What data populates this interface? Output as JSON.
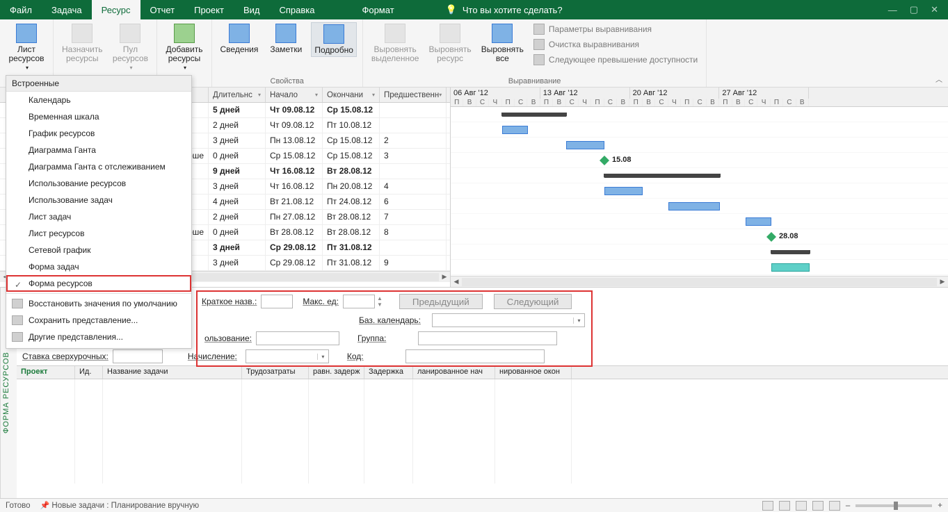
{
  "tabs": [
    "Файл",
    "Задача",
    "Ресурс",
    "Отчет",
    "Проект",
    "Вид",
    "Справка",
    "Формат"
  ],
  "active_tab_index": 2,
  "tellme": "Что вы хотите сделать?",
  "ribbon": {
    "group1": {
      "big1": "Лист\nресурсов",
      "drop": "▾"
    },
    "group2": {
      "b1": "Назначить\nресурсы",
      "b2": "Пул\nресурсов",
      "drop": "▾"
    },
    "group3": {
      "b1": "Добавить\nресурсы",
      "drop": "▾"
    },
    "group4": {
      "b1": "Сведения",
      "b2": "Заметки",
      "b3": "Подробно",
      "label": "Свойства"
    },
    "group5": {
      "b1": "Выровнять\nвыделенное",
      "b2": "Выровнять\nресурс",
      "b3": "Выровнять\nвсе",
      "s1": "Параметры выравнивания",
      "s2": "Очистка выравнивания",
      "s3": "Следующее превышение доступности",
      "label": "Выравнивание"
    }
  },
  "dropdown": {
    "header": "Встроенные",
    "items": [
      "Календарь",
      "Временная шкала",
      "График ресурсов",
      "Диаграмма Ганта",
      "Диаграмма Ганта с отслеживанием",
      "Использование ресурсов",
      "Использование задач",
      "Лист задач",
      "Лист ресурсов",
      "Сетевой график",
      "Форма задач",
      "Форма ресурсов"
    ],
    "footer": [
      "Восстановить значения по умолчанию",
      "Сохранить представление...",
      "Другие представления..."
    ]
  },
  "cols": [
    "Длительнс",
    "Начало",
    "Окончани",
    "Предшественн"
  ],
  "rows": [
    {
      "bold": true,
      "pre": "",
      "dur": "5 дней",
      "s": "Чт 09.08.12",
      "e": "Ср 15.08.12",
      "p": ""
    },
    {
      "bold": false,
      "pre": "",
      "dur": "2 дней",
      "s": "Чт 09.08.12",
      "e": "Пт 10.08.12",
      "p": ""
    },
    {
      "bold": false,
      "pre": "",
      "dur": "3 дней",
      "s": "Пн 13.08.12",
      "e": "Ср 15.08.12",
      "p": "2"
    },
    {
      "bold": false,
      "pre": "эше",
      "dur": "0 дней",
      "s": "Ср 15.08.12",
      "e": "Ср 15.08.12",
      "p": "3"
    },
    {
      "bold": true,
      "pre": "",
      "dur": "9 дней",
      "s": "Чт 16.08.12",
      "e": "Вт 28.08.12",
      "p": ""
    },
    {
      "bold": false,
      "pre": "",
      "dur": "3 дней",
      "s": "Чт 16.08.12",
      "e": "Пн 20.08.12",
      "p": "4"
    },
    {
      "bold": false,
      "pre": "",
      "dur": "4 дней",
      "s": "Вт 21.08.12",
      "e": "Пт 24.08.12",
      "p": "6"
    },
    {
      "bold": false,
      "pre": "",
      "dur": "2 дней",
      "s": "Пн 27.08.12",
      "e": "Вт 28.08.12",
      "p": "7"
    },
    {
      "bold": false,
      "pre": "эше",
      "dur": "0 дней",
      "s": "Вт 28.08.12",
      "e": "Вт 28.08.12",
      "p": "8"
    },
    {
      "bold": true,
      "pre": "",
      "dur": "3 дней",
      "s": "Ср 29.08.12",
      "e": "Пт 31.08.12",
      "p": ""
    },
    {
      "bold": false,
      "pre": "",
      "dur": "3 дней",
      "s": "Ср 29.08.12",
      "e": "Пт 31.08.12",
      "p": "9"
    }
  ],
  "weeks": [
    "06 Авг '12",
    "13 Авг '12",
    "20 Авг '12",
    "27 Авг '12"
  ],
  "days": [
    "П",
    "В",
    "С",
    "Ч",
    "П",
    "С",
    "В"
  ],
  "labels": {
    "ms1": "15.08",
    "ms2": "28.08"
  },
  "form": {
    "kn": "Краткое назв.:",
    "me": "Макс. ед:",
    "prev": "Предыдущий",
    "next": "Следующий",
    "bk": "Баз. календарь:",
    "grp": "Группа:",
    "kod": "Код:",
    "usage": "ользование:",
    "over": "Ставка сверхурочных:",
    "nach": "Начисление:"
  },
  "bottom_cols": [
    "Проект",
    "Ид.",
    "Название задачи",
    "Трудозатраты",
    "равн. задерж",
    "Задержка",
    "ланированное нач",
    "нированное окон"
  ],
  "left_strip": "ФОРМА РЕСУРСОВ",
  "status": {
    "ready": "Готово",
    "newtasks": "Новые задачи : Планирование вручную"
  }
}
